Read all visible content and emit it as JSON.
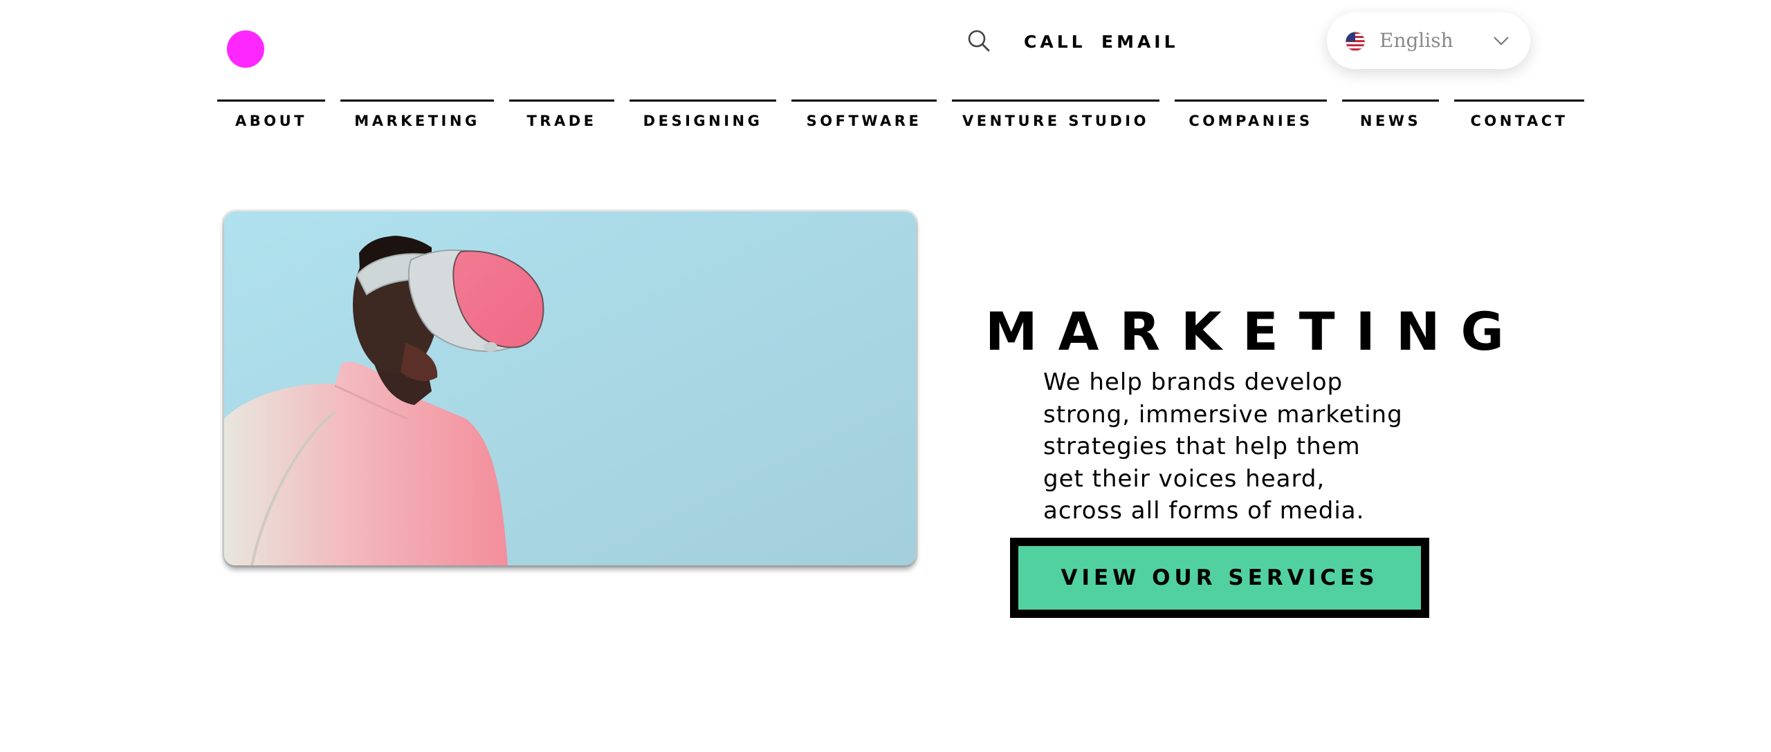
{
  "header": {
    "logo_icon": "pink-circle-logo-icon",
    "search_icon": "search-icon",
    "call_label": "CALL",
    "email_label": "EMAIL",
    "language": {
      "flag_icon": "us-flag-icon",
      "selected": "English",
      "chevron_icon": "chevron-down-icon"
    }
  },
  "nav": {
    "items": [
      {
        "label": "ABOUT"
      },
      {
        "label": "MARKETING"
      },
      {
        "label": "TRADE"
      },
      {
        "label": "DESIGNING"
      },
      {
        "label": "SOFTWARE"
      },
      {
        "label": "VENTURE STUDIO"
      },
      {
        "label": "COMPANIES"
      },
      {
        "label": "NEWS"
      },
      {
        "label": "CONTACT"
      }
    ]
  },
  "hero": {
    "image_subject": "person-wearing-vr-headset-image",
    "heading": "MARKETING",
    "body": "We help brands develop strong, immersive marketing strategies that help them get their voices heard, across all forms of media.",
    "cta_label": "VIEW OUR SERVICES"
  },
  "colors": {
    "logo": "#ff27ff",
    "cta_background": "#52d1a0",
    "cta_border": "#000000",
    "hero_background": "#a9d9e6",
    "text": "#000000"
  }
}
